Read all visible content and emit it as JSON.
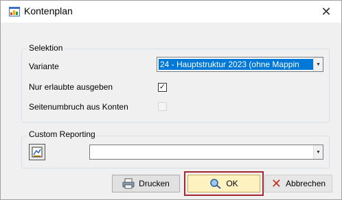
{
  "window": {
    "title": "Kontenplan",
    "close_symbol": "✕"
  },
  "selection_group": {
    "label": "Selektion",
    "variante_label": "Variante",
    "variante_value": "24 - Hauptstruktur 2023 (ohne Mappin",
    "only_allowed_label": "Nur erlaubte ausgeben",
    "only_allowed_checked": true,
    "page_break_label": "Seitenumbruch aus Konten",
    "page_break_checked": false
  },
  "custom_reporting_group": {
    "label": "Custom Reporting",
    "report_value": ""
  },
  "buttons": {
    "print_label": "Drucken",
    "ok_label": "OK",
    "cancel_label": "Abbrechen"
  },
  "icons": {
    "app": "chart-window-icon",
    "report": "report-designer-icon",
    "print": "printer-icon",
    "ok": "ok-magnifier-icon",
    "cancel": "x-icon"
  },
  "colors": {
    "selection_highlight": "#0078d7",
    "ok_button_bg": "#fdf2c0",
    "ok_focus_frame": "#a4262c",
    "cancel_x": "#c42b1c"
  }
}
